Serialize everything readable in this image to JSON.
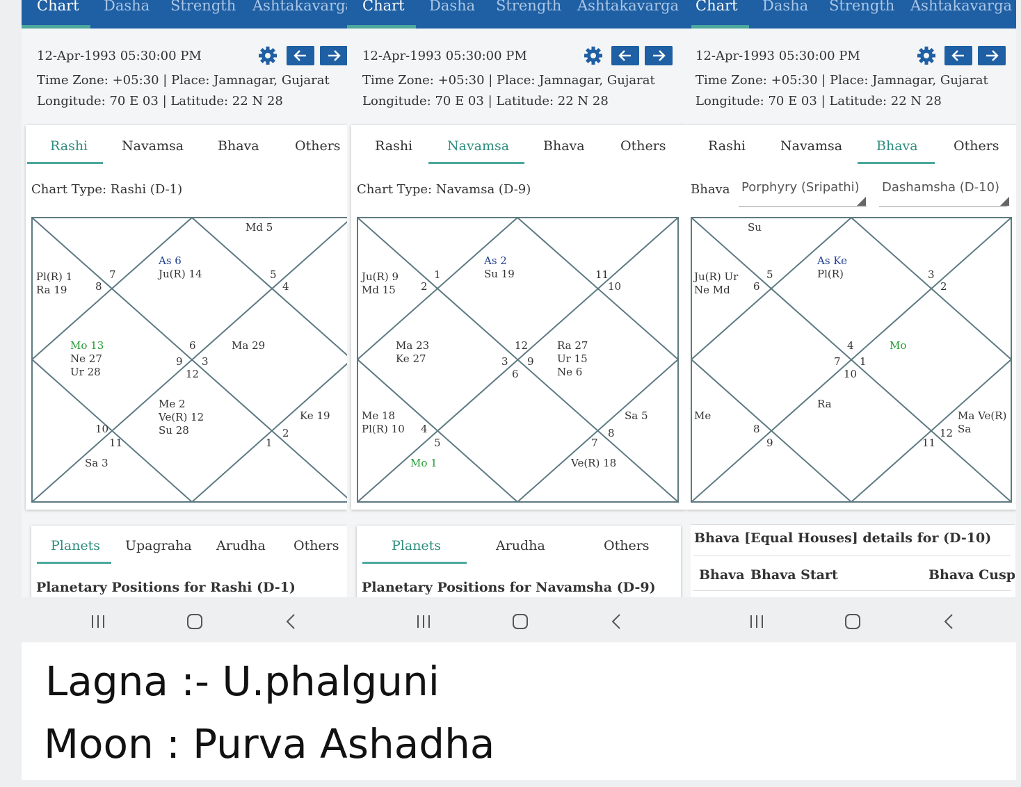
{
  "top_tabs": [
    "Chart",
    "Dasha",
    "Strength",
    "Ashtakavarga"
  ],
  "date_time": "12-Apr-1993 05:30:00 PM",
  "timezone_place": "Time Zone: +05:30 | Place: Jamnagar, Gujarat",
  "lon_lat": "Longitude: 70 E 03 | Latitude: 22 N 28",
  "chart_tabs": [
    "Rashi",
    "Navamsa",
    "Bhava",
    "Others"
  ],
  "panels": [
    {
      "chart_type": "Chart Type: Rashi (D-1)",
      "house_labels": {
        "top_right": [
          "Md 5"
        ],
        "top_center": [
          "As 6",
          "Ju(R) 14"
        ],
        "left_upper": [
          "Pl(R) 1",
          "Ra 19"
        ],
        "left_center": [
          "Mo 13",
          "Ne 27",
          "Ur 28"
        ],
        "right_center": [
          "Ma 29"
        ],
        "bottom_center": [
          "Me 2",
          "Ve(R) 12",
          "Su 28"
        ],
        "right_lower": [
          "Ke 19"
        ],
        "bottom_left": [
          "Sa 3"
        ]
      },
      "numbers": {
        "n7": "7",
        "n8": "8",
        "n5": "5",
        "n4": "4",
        "n6": "6",
        "n9": "9",
        "n3": "3",
        "n12": "12",
        "n10": "10",
        "n11": "11",
        "n2": "2",
        "n1": "1"
      },
      "sub_tabs": [
        "Planets",
        "Upagraha",
        "Arudha",
        "Others"
      ],
      "sub_title": "Planetary Positions for Rashi (D-1)"
    },
    {
      "chart_type": "Chart Type: Navamsa (D-9)",
      "house_labels": {
        "top_center": [
          "As 2",
          "Su 19"
        ],
        "left_upper": [
          "Ju(R) 9",
          "Md 15"
        ],
        "left_center": [
          "Ma 23",
          "Ke 27"
        ],
        "right_center": [
          "Ra 27",
          "Ur 15",
          "Ne 6"
        ],
        "left_lower": [
          "Me 18",
          "Pl(R) 10"
        ],
        "bottom_left": [
          "Mo 1"
        ],
        "right_lower": [
          "Sa 5"
        ],
        "bottom_right": [
          "Ve(R) 18"
        ]
      },
      "numbers": {
        "n1": "1",
        "n2": "2",
        "n11": "11",
        "n10": "10",
        "n12": "12",
        "n3": "3",
        "n9": "9",
        "n6": "6",
        "n4": "4",
        "n5": "5",
        "n8": "8",
        "n7": "7"
      },
      "sub_tabs": [
        "Planets",
        "Arudha",
        "Others"
      ],
      "sub_title": "Planetary Positions for Navamsha (D-9)"
    },
    {
      "bhava_label": "Bhava",
      "select1": "Porphyry (Sripathi)",
      "select2": "Dashamsha (D-10)",
      "house_labels": {
        "top_left": [
          "Su"
        ],
        "top_center": [
          "As Ke",
          "Pl(R)"
        ],
        "left_upper": [
          "Ju(R) Ur",
          "Ne Md"
        ],
        "right_center": [
          "Mo"
        ],
        "bottom_center": [
          "Ra"
        ],
        "left_lower": [
          "Me"
        ],
        "right_lower": [
          "Ma Ve(R)",
          "Sa"
        ]
      },
      "numbers": {
        "n5": "5",
        "n6": "6",
        "n3": "3",
        "n2": "2",
        "n4": "4",
        "n7": "7",
        "n1": "1",
        "n10": "10",
        "n8": "8",
        "n9": "9",
        "n12": "12",
        "n11": "11"
      },
      "details_title": "Bhava [Equal Houses] details for (D-10)",
      "table_headers": [
        "Bhava",
        "Bhava Start",
        "Bhava Cusp"
      ]
    }
  ],
  "caption": {
    "line1": "Lagna :- U.phalguni",
    "line2": "Moon : Purva Ashadha"
  }
}
